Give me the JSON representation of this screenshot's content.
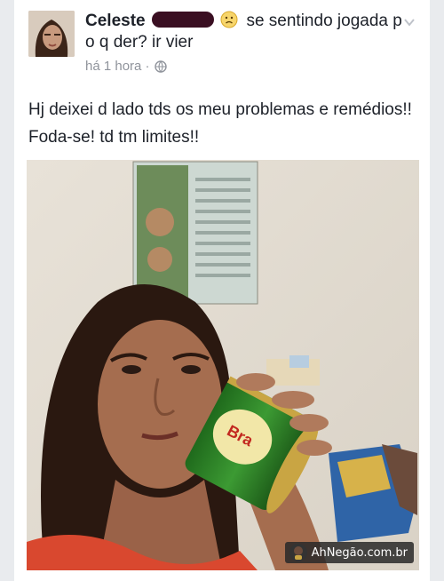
{
  "post": {
    "author": "Celeste",
    "status_text": "se sentindo jogada p o q der? ir vier",
    "timestamp": "há 1 hora ·",
    "privacy_icon": "globe-icon",
    "feeling_icon": "sad-face-emoji",
    "body": "Hj deixei d lado tds os meu problemas e remédios!! Foda-se! td tm limites!!"
  },
  "watermark": {
    "text": "AhNegão.com.br"
  },
  "colors": {
    "background": "#e9ebee",
    "text": "#1d2129",
    "meta": "#90949c",
    "can_green": "#2e7d2a"
  }
}
